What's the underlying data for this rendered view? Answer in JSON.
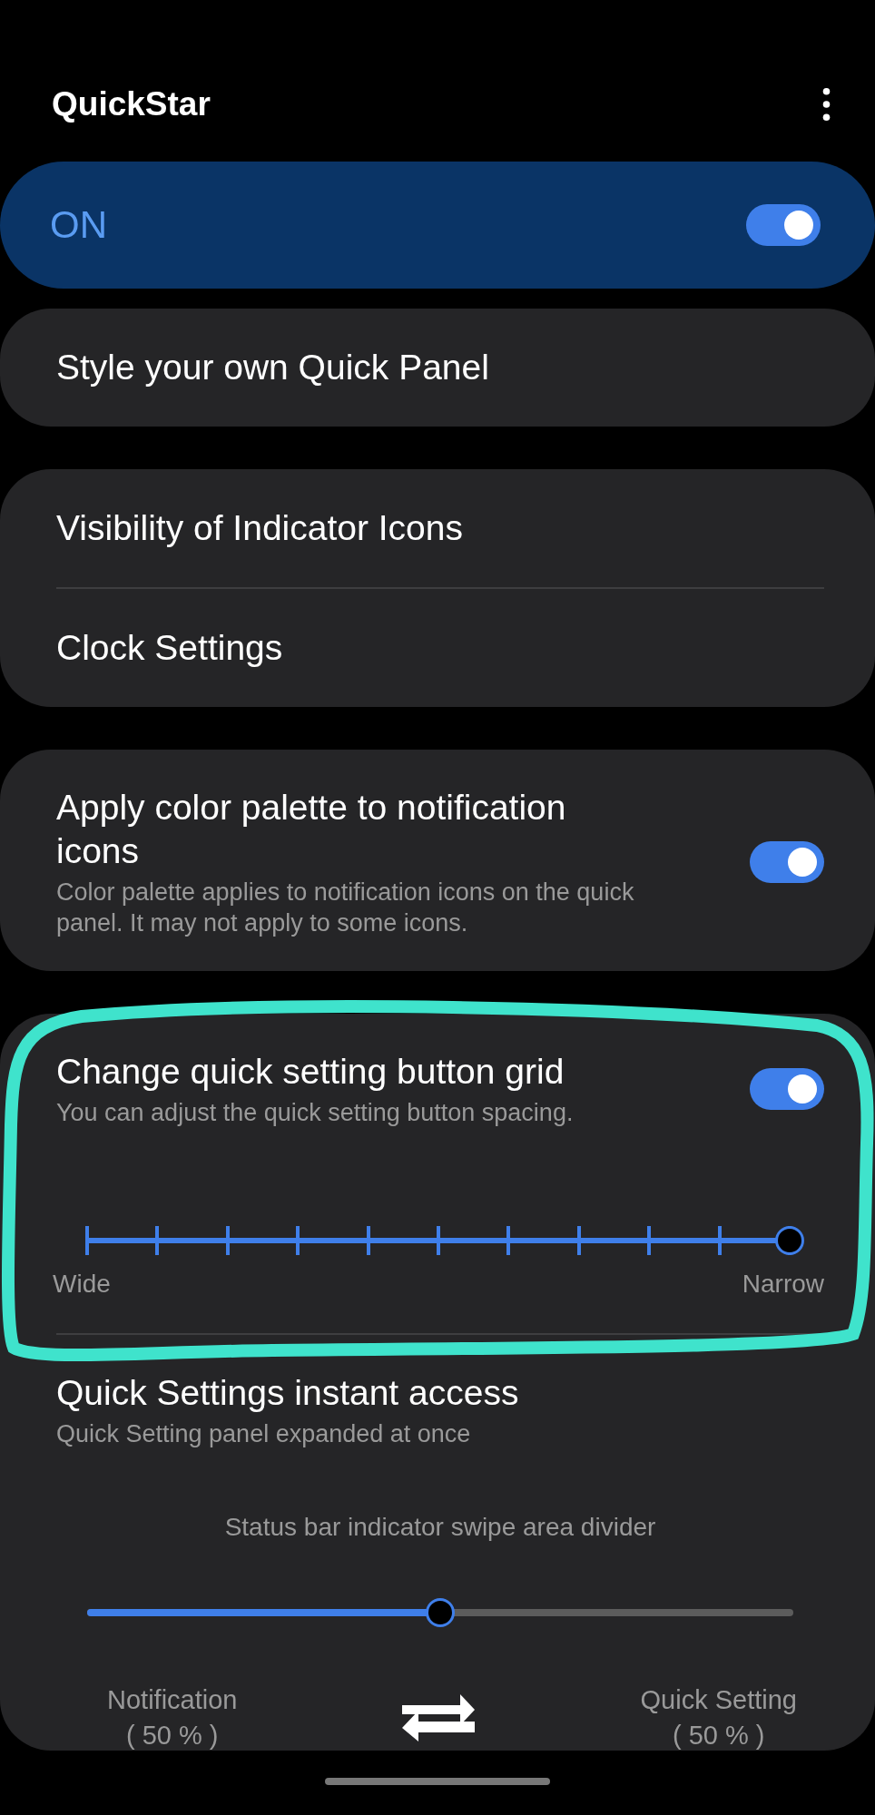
{
  "app_bar": {
    "title": "QuickStar"
  },
  "master": {
    "label": "ON",
    "on": true
  },
  "cards": [
    {
      "items": [
        {
          "kind": "link",
          "title": "Style your own Quick Panel"
        }
      ]
    },
    {
      "items": [
        {
          "kind": "link",
          "title": "Visibility of Indicator Icons"
        },
        {
          "kind": "link",
          "title": "Clock Settings"
        }
      ]
    },
    {
      "items": [
        {
          "kind": "switch",
          "title": "Apply color palette to notification icons",
          "subtitle": "Color palette applies to notification icons on the quick panel. It may not apply to some icons.",
          "on": true
        }
      ]
    },
    {
      "items": [
        {
          "kind": "stepslider",
          "title": "Change quick setting button grid",
          "subtitle": "You can adjust the quick setting button spacing.",
          "on": true,
          "level": 1,
          "min_label": "Wide",
          "max_label": "Narrow"
        },
        {
          "kind": "split",
          "title": "Quick Settings instant access",
          "subtitle": "Quick Setting panel expanded at once",
          "caption": "Status bar indicator swipe area divider",
          "level": 0.5,
          "left_label": "Notification",
          "left_value": "( 50 % )",
          "right_label": "Quick Setting",
          "right_value": "( 50 % )"
        }
      ]
    }
  ]
}
